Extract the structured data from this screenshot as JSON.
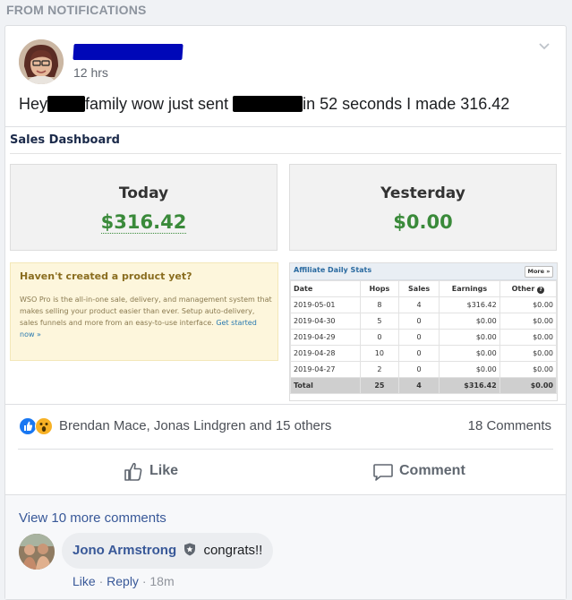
{
  "section_label": "FROM NOTIFICATIONS",
  "post": {
    "time": "12 hrs",
    "text_parts": [
      "Hey",
      "family wow just sent",
      "in 52 seconds I made 316.42"
    ]
  },
  "dashboard": {
    "title": "Sales Dashboard",
    "today_label": "Today",
    "today_value": "$316.42",
    "yesterday_label": "Yesterday",
    "yesterday_value": "$0.00",
    "promo_heading": "Haven't created a product yet?",
    "promo_body": "WSO Pro is the all-in-one sale, delivery, and management system that makes selling your product easier than ever. Setup auto-delivery, sales funnels and more from an easy-to-use interface.",
    "promo_link": "Get started now »",
    "affiliate": {
      "title": "Affiliate Daily Stats",
      "more_label": "More »",
      "columns": [
        "Date",
        "Hops",
        "Sales",
        "Earnings",
        "Other"
      ],
      "rows": [
        [
          "2019-05-01",
          "8",
          "4",
          "$316.42",
          "$0.00"
        ],
        [
          "2019-04-30",
          "5",
          "0",
          "$0.00",
          "$0.00"
        ],
        [
          "2019-04-29",
          "0",
          "0",
          "$0.00",
          "$0.00"
        ],
        [
          "2019-04-28",
          "10",
          "0",
          "$0.00",
          "$0.00"
        ],
        [
          "2019-04-27",
          "2",
          "0",
          "$0.00",
          "$0.00"
        ]
      ],
      "total": [
        "Total",
        "25",
        "4",
        "$316.42",
        "$0.00"
      ]
    }
  },
  "reactions": {
    "names": "Brendan Mace, Jonas Lindgren and 15 others",
    "comments_count": "18 Comments",
    "icons": [
      "like-reaction-icon",
      "wow-reaction-icon"
    ]
  },
  "actions": {
    "like": "Like",
    "comment": "Comment"
  },
  "comments": {
    "view_more": "View 10 more comments",
    "items": [
      {
        "author": "Jono Armstrong",
        "text": "congrats!!",
        "like": "Like",
        "reply": "Reply",
        "time": "18m"
      }
    ]
  },
  "colors": {
    "link": "#385898",
    "money_green": "#3a8a3a",
    "like_blue": "#1877f2",
    "redaction_name": "#0008b8"
  }
}
